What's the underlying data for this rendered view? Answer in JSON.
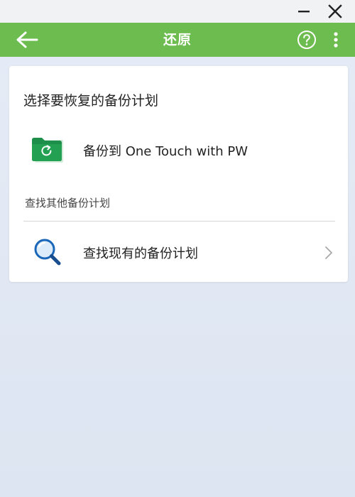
{
  "app": {
    "title": "还原"
  },
  "titlebar": {
    "minimize_icon": "minimize-icon",
    "close_icon": "close-icon"
  },
  "appbar": {
    "back_icon": "arrow-left-icon",
    "help_icon": "help-circle-icon",
    "more_icon": "more-vertical-icon"
  },
  "main": {
    "heading": "选择要恢复的备份计划",
    "plans": [
      {
        "label": "备份到 One Touch with PW",
        "icon": "green-folder-restore-icon"
      }
    ],
    "other_section_label": "查找其他备份计划",
    "find_existing": {
      "label": "查找现有的备份计划",
      "icon": "magnifier-icon",
      "chevron_icon": "chevron-right-icon"
    }
  },
  "colors": {
    "accent_green": "#6cbc4f",
    "background": "#dfe7f4",
    "card": "#ffffff",
    "folder_green": "#1e8f4a"
  }
}
